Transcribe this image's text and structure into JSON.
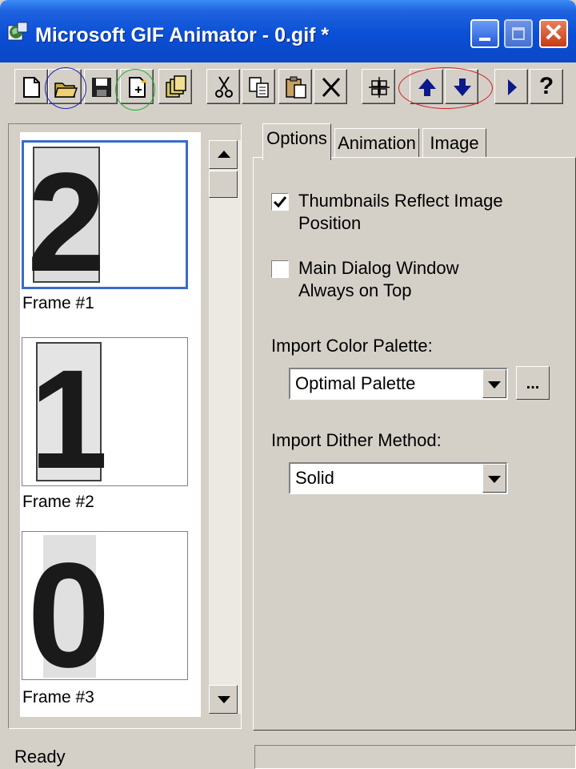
{
  "window": {
    "title": "Microsoft GIF Animator - 0.gif *"
  },
  "toolbar": {
    "buttons": [
      {
        "name": "new",
        "icon": "new-file-icon"
      },
      {
        "name": "open",
        "icon": "open-folder-icon"
      },
      {
        "name": "save",
        "icon": "save-disk-icon"
      },
      {
        "name": "insert",
        "icon": "insert-file-icon"
      },
      {
        "name": "save-as",
        "icon": "save-as-icon"
      },
      {
        "name": "cut",
        "icon": "scissors-icon"
      },
      {
        "name": "copy",
        "icon": "copy-icon"
      },
      {
        "name": "paste",
        "icon": "paste-icon"
      },
      {
        "name": "delete",
        "icon": "delete-x-icon"
      },
      {
        "name": "select-all",
        "icon": "select-all-icon"
      },
      {
        "name": "move-up",
        "icon": "arrow-up-icon"
      },
      {
        "name": "move-down",
        "icon": "arrow-down-icon"
      },
      {
        "name": "preview",
        "icon": "play-icon"
      },
      {
        "name": "help",
        "icon": "help-icon",
        "label": "?"
      }
    ]
  },
  "frames": [
    {
      "label": "Frame #1",
      "digit": "2",
      "selected": true
    },
    {
      "label": "Frame #2",
      "digit": "1",
      "selected": false
    },
    {
      "label": "Frame #3",
      "digit": "0",
      "selected": false
    }
  ],
  "tabs": [
    {
      "label": "Options",
      "active": true
    },
    {
      "label": "Animation",
      "active": false
    },
    {
      "label": "Image",
      "active": false
    }
  ],
  "options": {
    "thumbnails_reflect": {
      "line1": "Thumbnails Reflect Image",
      "line2": "Position",
      "checked": true
    },
    "always_on_top": {
      "line1": "Main Dialog Window",
      "line2": "Always on Top",
      "checked": false
    },
    "import_palette_label": "Import Color Palette:",
    "import_palette_value": "Optimal Palette",
    "ellipsis_label": "...",
    "import_dither_label": "Import Dither Method:",
    "import_dither_value": "Solid"
  },
  "status": {
    "text": "Ready"
  },
  "colors": {
    "title_bar": "#0a4fd6",
    "chrome": "#d4d0c8",
    "selection": "#3a6bc8",
    "close": "#c83c14"
  }
}
